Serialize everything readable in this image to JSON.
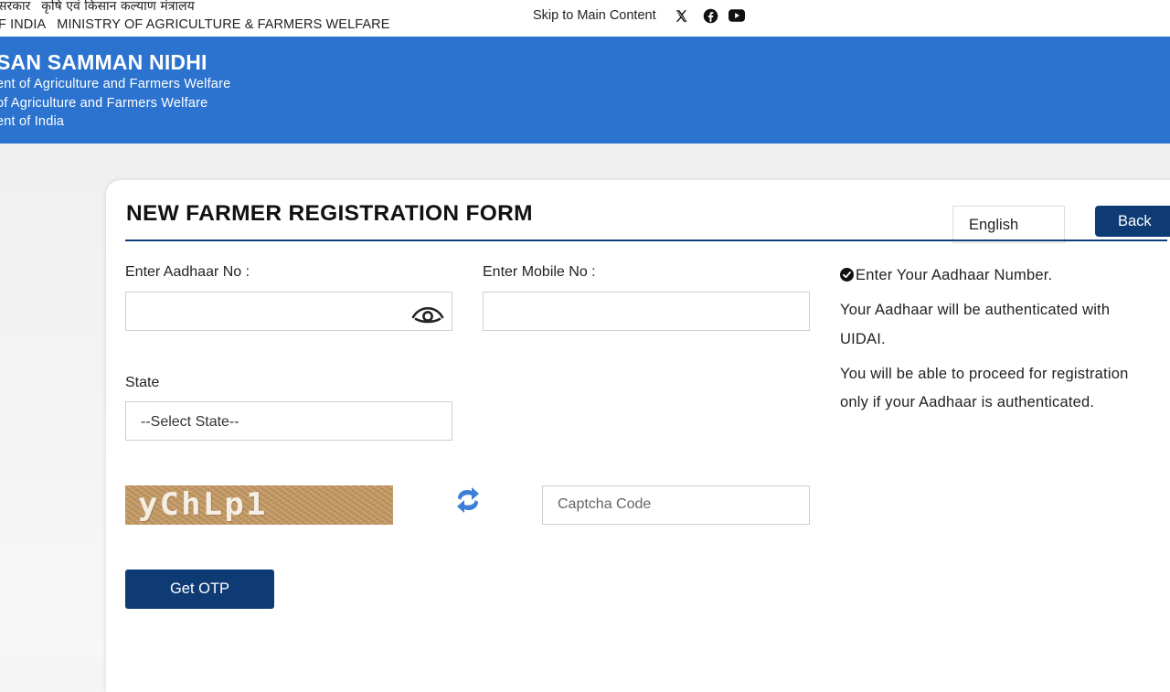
{
  "topbar": {
    "gov_hi_left": "सरकार",
    "gov_hi_right": "कृषि एवं किसान कल्याण मंत्रालय",
    "gov_en_left": "F INDIA",
    "gov_en_right": "MINISTRY OF AGRICULTURE & FARMERS WELFARE",
    "skip_link": "Skip to Main Content",
    "social_icons": [
      "x-icon",
      "facebook-icon",
      "youtube-icon"
    ]
  },
  "header": {
    "title": "SAN SAMMAN NIDHI",
    "line1": "ent of Agriculture and Farmers Welfare",
    "line2": "of Agriculture and Farmers Welfare",
    "line3": "ent of India",
    "bg_color": "#2b73cf"
  },
  "form": {
    "title": "NEW FARMER REGISTRATION FORM",
    "language": "English",
    "back_label": "Back",
    "aadhaar_label": "Enter Aadhaar No :",
    "aadhaar_value": "",
    "mobile_label": "Enter Mobile No :",
    "mobile_value": "",
    "state_label": "State",
    "state_selected": "--Select State--",
    "captcha_text": "yChLp1",
    "captcha_placeholder": "Captcha Code",
    "otp_label": "Get OTP",
    "accent_color": "#0e3b74"
  },
  "info": {
    "line1": "Enter Your Aadhaar Number.",
    "line2": "Your Aadhaar will be authenticated with",
    "line3": "UIDAI.",
    "line4": "You will be able to proceed for registration",
    "line5": "only if your Aadhaar is authenticated."
  }
}
